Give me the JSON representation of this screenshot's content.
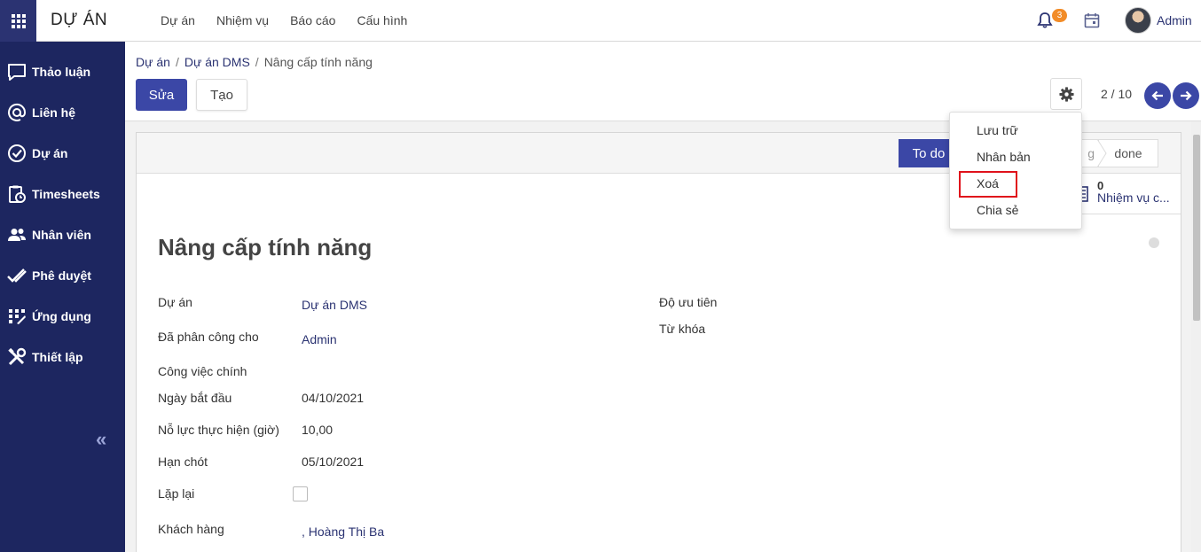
{
  "app": {
    "title": "DỰ ÁN"
  },
  "topnav": {
    "items": [
      "Dự án",
      "Nhiệm vụ",
      "Báo cáo",
      "Cấu hình"
    ]
  },
  "header": {
    "notification_count": "3",
    "user": "Admin"
  },
  "sidebar": {
    "items": [
      {
        "label": "Thảo luận",
        "icon": "chat-icon"
      },
      {
        "label": "Liên hệ",
        "icon": "at-icon"
      },
      {
        "label": "Dự án",
        "icon": "check-circle-icon"
      },
      {
        "label": "Timesheets",
        "icon": "clipboard-clock-icon"
      },
      {
        "label": "Nhân viên",
        "icon": "people-icon"
      },
      {
        "label": "Phê duyệt",
        "icon": "double-check-icon"
      },
      {
        "label": "Ứng dụng",
        "icon": "grid-icon"
      },
      {
        "label": "Thiết lập",
        "icon": "tools-icon"
      }
    ],
    "collapse": "«"
  },
  "breadcrumb": {
    "root": "Dự án",
    "parent": "Dự án DMS",
    "current": "Nâng cấp tính năng",
    "sep": "/"
  },
  "toolbar": {
    "edit_label": "Sửa",
    "create_label": "Tạo",
    "pager": "2 / 10"
  },
  "status": {
    "todo": "To do",
    "mid": "g",
    "done": "done"
  },
  "smart_button": {
    "count": "0",
    "label": "Nhiệm vụ c..."
  },
  "form": {
    "title": "Nâng cấp tính năng",
    "fields": {
      "project_label": "Dự án",
      "project_value": "Dự án DMS",
      "assigned_label": "Đã phân công cho",
      "assigned_value": "Admin",
      "parent_label": "Công việc chính",
      "start_label": "Ngày bắt đầu",
      "start_value": "04/10/2021",
      "effort_label": "Nỗ lực thực hiện (giờ)",
      "effort_value": "10,00",
      "deadline_label": "Hạn chót",
      "deadline_value": "05/10/2021",
      "repeat_label": "Lặp lại",
      "customer_label": "Khách hàng",
      "customer_value": ", Hoàng Thị Ba",
      "priority_label": "Độ ưu tiên",
      "tags_label": "Từ khóa"
    }
  },
  "dropdown": {
    "items": [
      "Lưu trữ",
      "Nhân bản",
      "Xoá",
      "Chia sẻ"
    ]
  },
  "colors": {
    "sidebar": "#1d2660",
    "primary": "#3b47a6",
    "badge": "#f28c28",
    "highlight": "#e0121b"
  }
}
